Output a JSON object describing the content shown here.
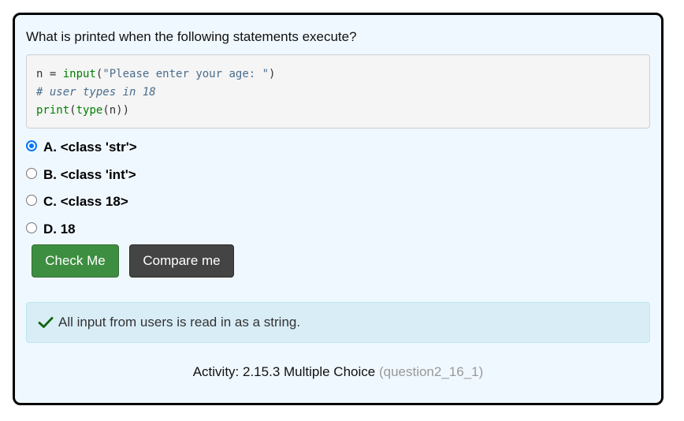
{
  "question": {
    "prompt": "What is printed when the following statements execute?"
  },
  "code": {
    "line1": {
      "a": "n = ",
      "b": "input",
      "c": "(",
      "d": "\"Please enter your age: \"",
      "e": ")"
    },
    "line2": "# user types in 18",
    "line3": {
      "a": "print",
      "b": "(",
      "c": "type",
      "d": "(n))"
    }
  },
  "choices": [
    {
      "label": "A. <class 'str'>",
      "selected": true
    },
    {
      "label": "B. <class 'int'>",
      "selected": false
    },
    {
      "label": "C. <class 18>",
      "selected": false
    },
    {
      "label": "D. 18",
      "selected": false
    }
  ],
  "buttons": {
    "check_label": "Check Me",
    "compare_label": "Compare me"
  },
  "feedback": {
    "icon": "checkmark-icon",
    "text": "All input from users is read in as a string.",
    "color": "#1a7a1a"
  },
  "activity": {
    "label": "Activity: 2.15.3 Multiple Choice",
    "id": "(question2_16_1)"
  },
  "colors": {
    "check_button": "#3e8e41",
    "compare_button": "#444444",
    "radio_selected": "#0075ff",
    "card_background": "#f0f8ff",
    "feedback_background": "#d9edf7"
  }
}
